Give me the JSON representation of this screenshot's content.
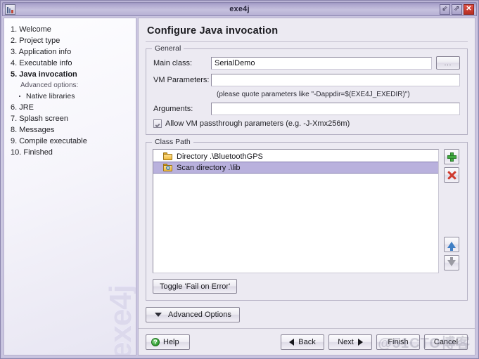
{
  "window": {
    "title": "exe4j",
    "icon": "app-icon",
    "buttons": {
      "minimize": "⇙",
      "maximize": "⇗",
      "close": "✕"
    }
  },
  "sidebar": {
    "watermark": "exe4j",
    "steps": [
      {
        "label": "1. Welcome",
        "type": "step",
        "current": false
      },
      {
        "label": "2. Project type",
        "type": "step",
        "current": false
      },
      {
        "label": "3. Application info",
        "type": "step",
        "current": false
      },
      {
        "label": "4. Executable info",
        "type": "step",
        "current": false
      },
      {
        "label": "5. Java invocation",
        "type": "step",
        "current": true
      },
      {
        "label": "Advanced options:",
        "type": "sub",
        "current": false
      },
      {
        "label": "Native libraries",
        "type": "bullet",
        "current": false
      },
      {
        "label": "6. JRE",
        "type": "step",
        "current": false
      },
      {
        "label": "7. Splash screen",
        "type": "step",
        "current": false
      },
      {
        "label": "8. Messages",
        "type": "step",
        "current": false
      },
      {
        "label": "9. Compile executable",
        "type": "step",
        "current": false
      },
      {
        "label": "10. Finished",
        "type": "step",
        "current": false
      }
    ]
  },
  "main": {
    "page_title": "Configure Java invocation",
    "general": {
      "legend": "General",
      "main_class_label": "Main class:",
      "main_class_value": "SerialDemo",
      "browse_label": "...",
      "vm_parameters_label": "VM Parameters:",
      "vm_parameters_value": "",
      "hint": "(please quote parameters like \"-Dappdir=$(EXE4J_EXEDIR)\")",
      "arguments_label": "Arguments:",
      "arguments_value": "",
      "passthrough_label": "Allow VM passthrough parameters (e.g. -J-Xmx256m)",
      "passthrough_checked": true
    },
    "classpath": {
      "legend": "Class Path",
      "items": [
        {
          "label": "Directory .\\BluetoothGPS",
          "icon": "folder-icon",
          "selected": false
        },
        {
          "label": "Scan directory .\\lib",
          "icon": "scan-folder-icon",
          "selected": true
        }
      ],
      "tools": {
        "add": "add-entry",
        "remove": "remove-entry",
        "move_up": "move-up",
        "move_down": "move-down"
      },
      "toggle_label": "Toggle 'Fail on Error'"
    },
    "advanced_options_label": "Advanced Options"
  },
  "footer": {
    "help_label": "Help",
    "help_icon": "?",
    "back_label": "Back",
    "next_label": "Next",
    "finish_label": "Finish",
    "cancel_label": "Cancel"
  },
  "overlay_watermark": "@51CTO博客"
}
